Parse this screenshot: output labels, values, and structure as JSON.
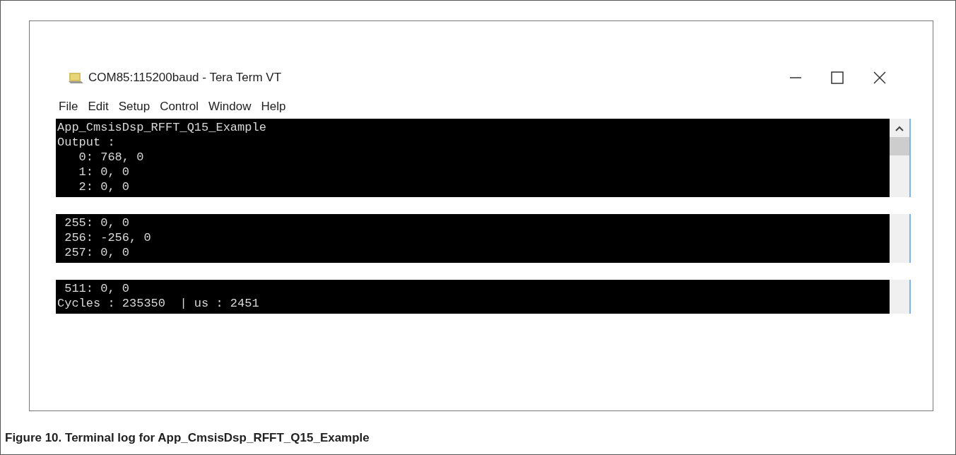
{
  "window": {
    "title": "COM85:115200baud - Tera Term VT"
  },
  "menu": [
    "File",
    "Edit",
    "Setup",
    "Control",
    "Window",
    "Help"
  ],
  "terminal_segments": [
    {
      "lines": [
        "App_CmsisDsp_RFFT_Q15_Example",
        "Output :",
        "   0: 768, 0",
        "   1: 0, 0",
        "   2: 0, 0"
      ]
    },
    {
      "lines": [
        " 255: 0, 0",
        " 256: -256, 0",
        " 257: 0, 0"
      ]
    },
    {
      "lines": [
        " 511: 0, 0",
        "Cycles : 235350  | us : 2451"
      ]
    }
  ],
  "caption": "Figure 10. Terminal log for App_CmsisDsp_RFFT_Q15_Example"
}
